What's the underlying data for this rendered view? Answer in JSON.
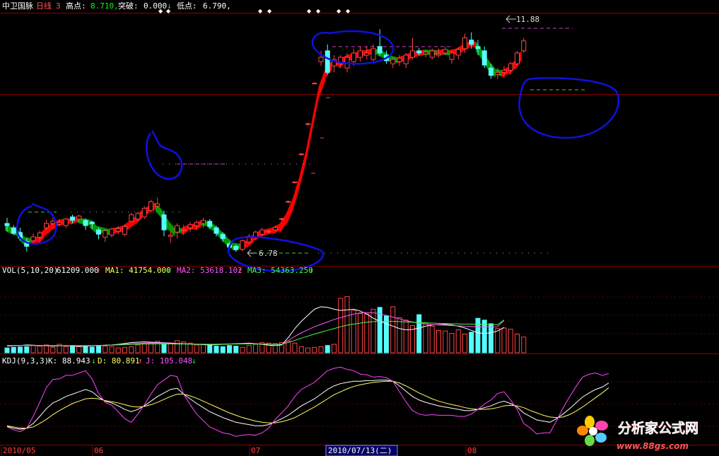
{
  "header": {
    "stock_name": "中卫国脉",
    "period": "日线",
    "formula_count": "3",
    "high_label": "高点:",
    "high_value": "8.710,",
    "breakout_label": "突破:",
    "breakout_value": "0.000",
    "breakout_arrow": "↓",
    "low_label": "低点:",
    "low_value": "6.790,"
  },
  "price_annotations": {
    "peak_label": "11.88",
    "trough_label": "6.78"
  },
  "volume_header": {
    "label": "VOL(5,10,20)",
    "vol_value": "61209.000",
    "vol_arrow": "↑",
    "ma1": "MA1: 41754.000",
    "ma1_arrow": "↓",
    "ma2": "MA2: 53618.102",
    "ma2_arrow": "↑",
    "ma3": "MA3: 54363.250",
    "ma3_arrow": "↓"
  },
  "kdj_header": {
    "label": "KDJ(9,3,3)",
    "k": "K: 88.943",
    "k_arrow": "↓",
    "d": "D: 80.891",
    "d_arrow": "↑",
    "j": "J: 105.048",
    "j_arrow": "↓"
  },
  "date_axis": {
    "labels": [
      "2010/05",
      "06",
      "07",
      "08"
    ],
    "cursor": "2010/07/13(二)"
  },
  "watermark": {
    "name": "分析家公式网",
    "url": "www.88gs.com"
  },
  "colors": {
    "up": "#ff4444",
    "down": "#54fcfc",
    "trend_up": "#ff0000",
    "trend_down": "#009900",
    "vol_ma1": "#ffffff",
    "vol_ma2": "#ff55ff",
    "vol_ma3": "#44ff44",
    "kdj_k": "#ffffff",
    "kdj_d": "#ffff66",
    "kdj_j": "#ff44ff",
    "annotation_circle": "#1010e0",
    "panel_line": "#8b0000"
  },
  "chart_data": [
    {
      "type": "candlestick",
      "ylim": [
        6.5,
        12.3
      ],
      "fields": [
        "open",
        "high",
        "low",
        "close"
      ],
      "candles": [
        [
          7.45,
          7.58,
          7.26,
          7.4
        ],
        [
          7.35,
          7.41,
          7.18,
          7.22
        ],
        [
          7.24,
          7.35,
          7.05,
          7.12
        ],
        [
          7.03,
          7.11,
          6.8,
          6.92
        ],
        [
          7.05,
          7.22,
          6.97,
          7.14
        ],
        [
          7.13,
          7.28,
          7.05,
          7.23
        ],
        [
          7.35,
          7.53,
          7.3,
          7.45
        ],
        [
          7.45,
          7.58,
          7.4,
          7.5
        ],
        [
          7.43,
          7.55,
          7.38,
          7.47
        ],
        [
          7.4,
          7.58,
          7.35,
          7.55
        ],
        [
          7.6,
          7.65,
          7.45,
          7.52
        ],
        [
          7.55,
          7.65,
          7.48,
          7.62
        ],
        [
          7.52,
          7.57,
          7.3,
          7.4
        ],
        [
          7.48,
          7.52,
          7.32,
          7.44
        ],
        [
          7.3,
          7.35,
          7.08,
          7.2
        ],
        [
          7.13,
          7.3,
          7.02,
          7.28
        ],
        [
          7.18,
          7.35,
          7.12,
          7.32
        ],
        [
          7.27,
          7.38,
          7.2,
          7.33
        ],
        [
          7.2,
          7.42,
          7.15,
          7.38
        ],
        [
          7.5,
          7.7,
          7.48,
          7.65
        ],
        [
          7.55,
          7.72,
          7.5,
          7.68
        ],
        [
          7.6,
          7.85,
          7.55,
          7.8
        ],
        [
          7.75,
          8.0,
          7.7,
          7.95
        ],
        [
          7.85,
          8.05,
          7.8,
          7.9
        ],
        [
          7.65,
          7.75,
          7.15,
          7.3
        ],
        [
          7.15,
          7.28,
          7.0,
          7.18
        ],
        [
          7.25,
          7.45,
          7.1,
          7.4
        ],
        [
          7.28,
          7.42,
          7.18,
          7.3
        ],
        [
          7.35,
          7.48,
          7.25,
          7.42
        ],
        [
          7.4,
          7.52,
          7.3,
          7.47
        ],
        [
          7.45,
          7.58,
          7.35,
          7.52
        ],
        [
          7.5,
          7.55,
          7.32,
          7.38
        ],
        [
          7.35,
          7.4,
          7.15,
          7.22
        ],
        [
          7.2,
          7.25,
          7.02,
          7.1
        ],
        [
          6.98,
          7.02,
          6.85,
          6.9
        ],
        [
          6.92,
          6.96,
          6.79,
          6.84
        ],
        [
          6.85,
          7.08,
          6.8,
          7.05
        ],
        [
          7.02,
          7.2,
          6.98,
          7.15
        ],
        [
          7.12,
          7.28,
          7.08,
          7.25
        ],
        [
          7.2,
          7.35,
          7.12,
          7.3
        ],
        [
          7.26,
          7.3,
          7.22,
          7.27
        ],
        [
          7.3,
          7.4,
          7.28,
          7.36
        ],
        [
          7.55,
          7.58,
          7.52,
          7.56
        ],
        [
          7.95,
          7.98,
          7.92,
          7.96
        ],
        [
          8.4,
          8.42,
          8.38,
          8.41
        ],
        [
          9.05,
          9.08,
          9.02,
          9.06
        ],
        [
          9.75,
          9.78,
          9.72,
          9.76
        ],
        [
          10.7,
          10.72,
          10.68,
          10.7
        ],
        [
          11.2,
          11.45,
          11.1,
          11.3
        ],
        [
          11.45,
          11.6,
          10.9,
          10.95
        ],
        [
          11.1,
          11.35,
          10.95,
          11.25
        ],
        [
          11.15,
          11.35,
          11.05,
          11.3
        ],
        [
          11.05,
          11.4,
          10.95,
          11.3
        ],
        [
          11.2,
          11.5,
          11.1,
          11.4
        ],
        [
          11.3,
          11.55,
          11.2,
          11.45
        ],
        [
          11.35,
          11.55,
          11.25,
          11.4
        ],
        [
          11.25,
          11.6,
          11.2,
          11.5
        ],
        [
          11.55,
          11.95,
          11.35,
          11.4
        ],
        [
          11.35,
          11.45,
          11.15,
          11.22
        ],
        [
          11.15,
          11.3,
          11.05,
          11.25
        ],
        [
          11.2,
          11.35,
          11.1,
          11.28
        ],
        [
          11.15,
          11.4,
          11.05,
          11.35
        ],
        [
          11.3,
          11.75,
          11.25,
          11.45
        ],
        [
          11.45,
          11.52,
          11.35,
          11.4
        ],
        [
          11.38,
          11.48,
          11.3,
          11.42
        ],
        [
          11.3,
          11.5,
          11.25,
          11.45
        ],
        [
          11.35,
          11.5,
          11.3,
          11.38
        ],
        [
          11.4,
          11.55,
          11.35,
          11.48
        ],
        [
          11.25,
          11.45,
          11.15,
          11.4
        ],
        [
          11.35,
          11.52,
          11.25,
          11.48
        ],
        [
          11.5,
          11.85,
          11.4,
          11.75
        ],
        [
          11.7,
          11.88,
          11.5,
          11.6
        ],
        [
          11.55,
          11.7,
          11.35,
          11.5
        ],
        [
          11.45,
          11.55,
          11.05,
          11.12
        ],
        [
          11.05,
          11.15,
          10.8,
          10.88
        ],
        [
          10.9,
          11.05,
          10.8,
          10.95
        ],
        [
          10.95,
          11.1,
          10.82,
          11.0
        ],
        [
          11.0,
          11.2,
          10.9,
          11.15
        ],
        [
          11.15,
          11.45,
          11.1,
          11.4
        ],
        [
          11.45,
          11.75,
          11.4,
          11.68
        ]
      ]
    },
    {
      "type": "bar",
      "series_name": "VOL",
      "values": [
        8000,
        9000,
        9500,
        10000,
        12000,
        11000,
        13000,
        9000,
        14000,
        10000,
        12000,
        10000,
        11000,
        9500,
        12000,
        11000,
        10000,
        8000,
        9000,
        10000,
        13000,
        15000,
        17000,
        19000,
        14000,
        16000,
        20000,
        18000,
        16000,
        13000,
        14000,
        12000,
        11000,
        10000,
        12000,
        11000,
        9000,
        12000,
        14000,
        17000,
        16000,
        15000,
        17000,
        19000,
        16000,
        10000,
        8000,
        9000,
        10000,
        12000,
        14000,
        90000,
        93000,
        70000,
        65000,
        64000,
        72000,
        75000,
        61000,
        76000,
        58000,
        54000,
        45000,
        63000,
        49000,
        44000,
        37000,
        36000,
        32000,
        38000,
        31000,
        34000,
        57000,
        54000,
        48000,
        40000,
        41000,
        39000,
        31000,
        26000,
        29000,
        35000,
        35000,
        37000,
        61209
      ],
      "ylim": [
        0,
        125000
      ],
      "ma_series": [
        {
          "name": "MA1",
          "values": [
            11000,
            11500,
            12000,
            13000,
            12500,
            12000,
            11500,
            11000,
            11500,
            12000,
            11000,
            10500,
            11000,
            11500,
            12000,
            12500,
            13000,
            14000,
            15500,
            17000,
            17500,
            18000,
            17500,
            17000,
            16500,
            16000,
            15500,
            15000,
            14500,
            14000,
            13500,
            13000,
            13500,
            14000,
            14500,
            15000,
            15500,
            16000,
            15000,
            14000,
            12500,
            12000,
            13000,
            25000,
            40000,
            52000,
            62000,
            72000,
            76000,
            75000,
            72000,
            70000,
            71000,
            72000,
            69000,
            64000,
            57000,
            52000,
            48000,
            44000,
            40000,
            38000,
            38500,
            41000,
            44000,
            46000,
            46500,
            47000,
            46000,
            44000,
            41000,
            37000,
            33000,
            32000,
            33000,
            36000,
            41754
          ]
        },
        {
          "name": "MA2",
          "values": [
            11500,
            11700,
            12000,
            12200,
            12000,
            11800,
            11600,
            11500,
            11600,
            11700,
            11500,
            11400,
            11500,
            11700,
            12000,
            12300,
            12800,
            13500,
            14200,
            15000,
            15500,
            16000,
            16200,
            16000,
            15700,
            15400,
            15000,
            14700,
            14400,
            14200,
            14000,
            13800,
            14000,
            14300,
            14600,
            14900,
            15200,
            15400,
            15000,
            14600,
            14000,
            13800,
            14200,
            20000,
            27000,
            33000,
            38000,
            43000,
            47000,
            51000,
            55000,
            58000,
            61000,
            64000,
            66000,
            66500,
            66000,
            64500,
            62000,
            59000,
            56000,
            53000,
            51000,
            49000,
            47500,
            46500,
            46000,
            45500,
            45000,
            44500,
            44000,
            43500,
            43000,
            42500,
            42500,
            43000,
            53618
          ]
        },
        {
          "name": "MA3",
          "values": [
            12000,
            12100,
            12200,
            12300,
            12200,
            12100,
            12000,
            11900,
            11900,
            12000,
            11900,
            11800,
            11900,
            12000,
            12200,
            12400,
            12700,
            13000,
            13400,
            13800,
            14100,
            14400,
            14600,
            14700,
            14700,
            14600,
            14500,
            14400,
            14300,
            14200,
            14100,
            14000,
            14100,
            14200,
            14400,
            14500,
            14600,
            14700,
            14600,
            14400,
            14200,
            14000,
            14300,
            17000,
            20500,
            24000,
            27500,
            31000,
            34000,
            37000,
            40000,
            43000,
            45500,
            47500,
            49000,
            50500,
            51500,
            52000,
            52000,
            51800,
            51500,
            51000,
            50500,
            50000,
            49500,
            49000,
            48700,
            48400,
            48000,
            47800,
            47500,
            47300,
            47000,
            46800,
            46500,
            46300,
            54363
          ]
        }
      ]
    },
    {
      "type": "line",
      "series_name": "KDJ",
      "ylim": [
        -15,
        120
      ],
      "series": [
        {
          "name": "K",
          "values": [
            15,
            12,
            10,
            12,
            20,
            32,
            45,
            55,
            60,
            66,
            70,
            74,
            78,
            74,
            65,
            58,
            55,
            50,
            44,
            40,
            44,
            50,
            58,
            66,
            72,
            78,
            80,
            70,
            62,
            54,
            47,
            40,
            35,
            30,
            26,
            22,
            20,
            18,
            16,
            16,
            18,
            23,
            28,
            34,
            42,
            50,
            56,
            62,
            70,
            78,
            84,
            88,
            90,
            92,
            92,
            93,
            93,
            94,
            94,
            92,
            84,
            75,
            66,
            60,
            56,
            53,
            50,
            48,
            46,
            44,
            42,
            42,
            44,
            47,
            50,
            55,
            58,
            54,
            48,
            38,
            32,
            26,
            24,
            22,
            28,
            36,
            45,
            55,
            65,
            72,
            78,
            82,
            88.943
          ]
        },
        {
          "name": "D",
          "values": [
            16,
            14,
            12,
            12,
            14,
            20,
            27,
            35,
            42,
            48,
            54,
            58,
            62,
            63,
            62,
            59,
            57,
            55,
            52,
            49,
            48,
            49,
            52,
            56,
            61,
            66,
            70,
            70,
            67,
            63,
            58,
            53,
            48,
            43,
            38,
            34,
            30,
            27,
            24,
            22,
            21,
            21,
            23,
            26,
            30,
            36,
            42,
            48,
            55,
            62,
            69,
            74,
            79,
            83,
            86,
            88,
            90,
            91,
            92,
            92,
            89,
            84,
            78,
            72,
            67,
            62,
            58,
            55,
            52,
            50,
            47,
            45,
            44,
            44,
            45,
            47,
            50,
            51,
            50,
            47,
            42,
            38,
            34,
            31,
            30,
            31,
            35,
            41,
            48,
            56,
            64,
            72,
            80.891
          ]
        },
        {
          "name": "J",
          "values": [
            14,
            9,
            6,
            12,
            32,
            56,
            81,
            95,
            96,
            102,
            102,
            106,
            110,
            96,
            71,
            56,
            51,
            40,
            28,
            22,
            36,
            52,
            70,
            86,
            94,
            102,
            100,
            70,
            52,
            36,
            25,
            14,
            9,
            4,
            2,
            -2,
            0,
            1,
            0,
            4,
            12,
            27,
            38,
            50,
            66,
            78,
            84,
            90,
            100,
            110,
            114,
            116,
            112,
            110,
            104,
            103,
            99,
            100,
            98,
            92,
            74,
            57,
            42,
            36,
            34,
            35,
            34,
            34,
            34,
            32,
            32,
            36,
            44,
            53,
            60,
            71,
            74,
            60,
            44,
            20,
            12,
            2,
            4,
            4,
            24,
            46,
            65,
            83,
            99,
            104,
            106,
            102,
            105.048
          ]
        }
      ]
    }
  ]
}
